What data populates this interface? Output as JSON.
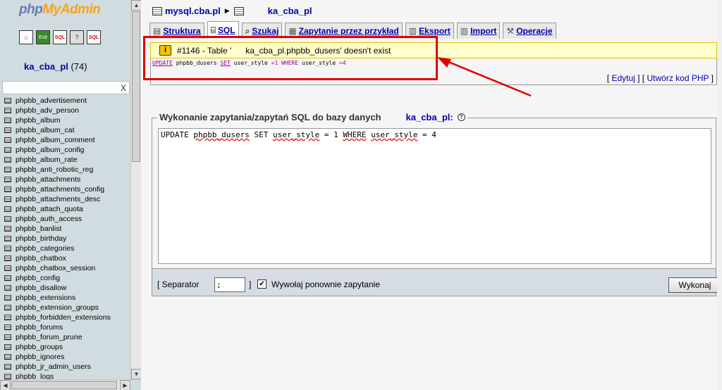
{
  "app": {
    "logo_part1": "php",
    "logo_part2": "MyAdmin"
  },
  "left_icons": [
    {
      "name": "home-icon",
      "glyph": "⌂"
    },
    {
      "name": "exit-icon",
      "glyph": "Exit"
    },
    {
      "name": "sql-query-icon",
      "glyph": "SQL"
    },
    {
      "name": "help-icon",
      "glyph": "?"
    },
    {
      "name": "sql-docs-icon",
      "glyph": "SQL"
    }
  ],
  "sidebar": {
    "db_name": "ka_cba_pl",
    "db_count": "(74)",
    "filter_clear": "X",
    "tables": [
      "phpbb_advertisement",
      "phpbb_adv_person",
      "phpbb_album",
      "phpbb_album_cat",
      "phpbb_album_comment",
      "phpbb_album_config",
      "phpbb_album_rate",
      "phpbb_anti_robotic_reg",
      "phpbb_attachments",
      "phpbb_attachments_config",
      "phpbb_attachments_desc",
      "phpbb_attach_quota",
      "phpbb_auth_access",
      "phpbb_banlist",
      "phpbb_birthday",
      "phpbb_categories",
      "phpbb_chatbox",
      "phpbb_chatbox_session",
      "phpbb_config",
      "phpbb_disallow",
      "phpbb_extensions",
      "phpbb_extension_groups",
      "phpbb_forbidden_extensions",
      "phpbb_forums",
      "phpbb_forum_prune",
      "phpbb_groups",
      "phpbb_ignores",
      "phpbb_jr_admin_users",
      "phpbb_logs"
    ]
  },
  "breadcrumb": {
    "server": "mysql.cba.pl",
    "database": "ka_cba_pl"
  },
  "tabs": [
    {
      "label": "Struktura",
      "icon": "structure-icon",
      "glyph": "▤",
      "active": false
    },
    {
      "label": "SQL",
      "icon": "sql-icon",
      "glyph": "⌸",
      "active": true
    },
    {
      "label": "Szukaj",
      "icon": "search-icon",
      "glyph": "⌕",
      "active": false
    },
    {
      "label": "Zapytanie przez przykład",
      "icon": "query-icon",
      "glyph": "▦",
      "active": false
    },
    {
      "label": "Eksport",
      "icon": "export-icon",
      "glyph": "▥",
      "active": false
    },
    {
      "label": "Import",
      "icon": "import-icon",
      "glyph": "▥",
      "active": false
    },
    {
      "label": "Operacje",
      "icon": "operations-icon",
      "glyph": "⚒",
      "active": false
    }
  ],
  "error": {
    "icon_glyph": "i",
    "code": "#1146 - Table '",
    "rest": "ka_cba_pl.phpbb_dusers' doesn't exist"
  },
  "sql_echo": {
    "kw_update": "UPDATE",
    "table": "phpbb_dusers",
    "kw_set": "SET",
    "col1": "user_style",
    "eq1": "=1",
    "kw_where": "WHERE",
    "col2": "user_style",
    "eq2": "=4"
  },
  "edit_links": {
    "open1": "[",
    "edit": "Edytuj",
    "mid": "] [",
    "php": "Utwórz kod PHP",
    "close": "]"
  },
  "query_form": {
    "legend": "Wykonanie zapytania/zapytań SQL do bazy danych",
    "legend_db": "ka_cba_pl:",
    "help_glyph": "?",
    "sql_parts": {
      "w1": "UPDATE",
      "w2": "phpbb_dusers",
      "w3": "SET",
      "w4": "user_style",
      "w5": "= 1",
      "w6": "WHERE",
      "w7": "user_style",
      "w8": "= 4"
    },
    "separator_open": "[ Separator",
    "separator_value": ";",
    "separator_close": "]",
    "rerun_checked": "✔",
    "rerun_label": "Wywołaj ponownie zapytanie",
    "submit_label": "Wykonaj"
  },
  "colors": {
    "annotation": "#e00000",
    "link": "#0000aa",
    "error_bg": "#ffffcc"
  }
}
